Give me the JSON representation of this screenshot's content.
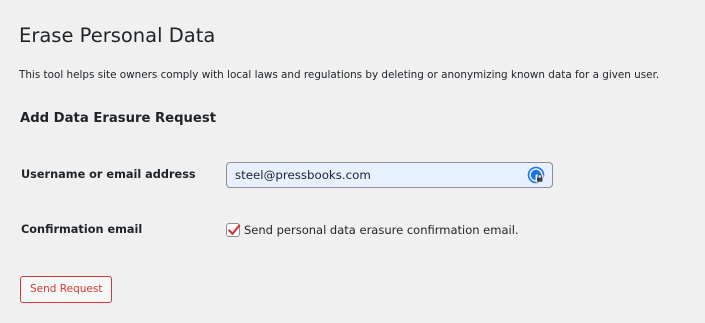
{
  "page": {
    "title": "Erase Personal Data",
    "description": "This tool helps site owners comply with local laws and regulations by deleting or anonymizing known data for a given user."
  },
  "form": {
    "section_title": "Add Data Erasure Request",
    "username_label": "Username or email address",
    "username_value": "steel@pressbooks.com",
    "confirmation_label": "Confirmation email",
    "confirmation_checkbox_checked": true,
    "confirmation_checkbox_text": "Send personal data erasure confirmation email.",
    "submit_label": "Send Request"
  },
  "icons": {
    "password_manager": "password-manager-icon",
    "checkmark": "checkmark-icon"
  },
  "colors": {
    "background": "#f0f0f1",
    "text": "#1d2327",
    "input_autofill_bg": "#e8f0fe",
    "danger": "#d63638"
  }
}
